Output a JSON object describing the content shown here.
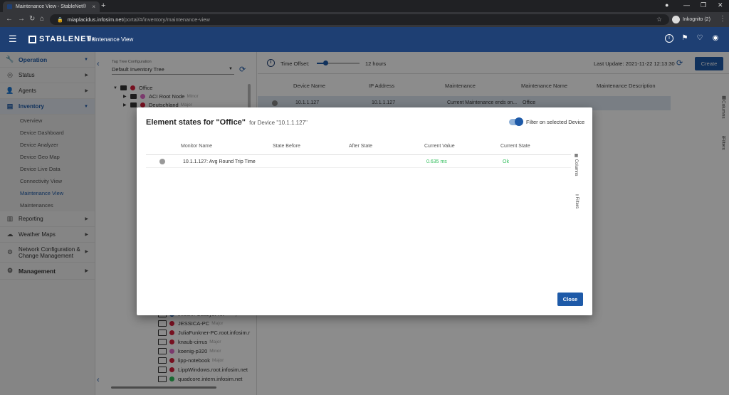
{
  "browser": {
    "tab_title": "Maintenance View - StableNet®",
    "tab_close": "×",
    "new_tab": "+",
    "url_host": "miaplacidus.infosim.net",
    "url_path": "/portal/#/inventory/maintenance-view",
    "incognito_label": "Inkognito (2)"
  },
  "appbar": {
    "logo": "STABLENET",
    "logo_tm": "®",
    "title": "Maintenance View"
  },
  "sidebar": {
    "operation": "Operation",
    "status": "Status",
    "agents": "Agents",
    "inventory": "Inventory",
    "inventory_items": [
      "Overview",
      "Device Dashboard",
      "Device Analyzer",
      "Device Geo Map",
      "Device Live Data",
      "Connectivity View",
      "Maintenance View",
      "Maintenances"
    ],
    "reporting": "Reporting",
    "weather_maps": "Weather Maps",
    "network_config_line1": "Network Configuration &",
    "network_config_line2": "Change Management",
    "management": "Management"
  },
  "tree": {
    "config_label": "Tag Tree Configuration",
    "config_value": "Default Inventory Tree",
    "nodes": [
      {
        "label": "Office",
        "sev": "",
        "color": "#d81e3b"
      },
      {
        "label": "ACI Root Node",
        "sev": "Minor",
        "color": "#e06ac6"
      },
      {
        "label": "Deutschland",
        "sev": "Major",
        "color": "#d81e3b"
      }
    ],
    "devices": [
      {
        "label": "infosim-Catalyst-nw",
        "sev": "Marginal",
        "color": "#1e5aa8"
      },
      {
        "label": "JESSICA-PC",
        "sev": "Major",
        "color": "#d81e3b"
      },
      {
        "label": "JuliaFunkner-PC.root.infosim.r",
        "sev": "",
        "color": "#d81e3b"
      },
      {
        "label": "knaub-cirrus",
        "sev": "Major",
        "color": "#d81e3b"
      },
      {
        "label": "koenig-p320",
        "sev": "Minor",
        "color": "#e06ac6"
      },
      {
        "label": "lipp-notebook",
        "sev": "Major",
        "color": "#d81e3b"
      },
      {
        "label": "LippWindows.root.infosim.net",
        "sev": "",
        "color": "#d81e3b"
      },
      {
        "label": "quadcore.intern.infosim.net",
        "sev": "",
        "color": "#2ebd59"
      }
    ]
  },
  "toolbar": {
    "time_offset_label": "Time Offset:",
    "time_offset_fraction": 0.2,
    "time_offset_value": "12 hours",
    "last_update": "Last Update: 2021-11-22 12:13:30",
    "create": "Create"
  },
  "table": {
    "headers": [
      "Device Name",
      "IP Address",
      "Maintenance",
      "Maintenance Name",
      "Maintenance Description"
    ],
    "row": {
      "device": "10.1.1.127",
      "ip": "10.1.1.127",
      "maintenance": "Current Maintenance ends on...",
      "name": "Office",
      "description": ""
    }
  },
  "side_tabs": {
    "columns": "Columns",
    "filters": "Filters"
  },
  "dialog": {
    "title": "Element states for \"Office\"",
    "subtitle": "for Device \"10.1.1.127\"",
    "filter_label": "Filter on selected Device",
    "headers": [
      "Monitor Name",
      "State Before",
      "After State",
      "Current Value",
      "Current State"
    ],
    "rows": [
      {
        "monitor": "10.1.1.127: Avg Round Trip Time",
        "before": "",
        "after": "",
        "value": "0.635 ms",
        "state": "Ok"
      }
    ],
    "close": "Close"
  }
}
